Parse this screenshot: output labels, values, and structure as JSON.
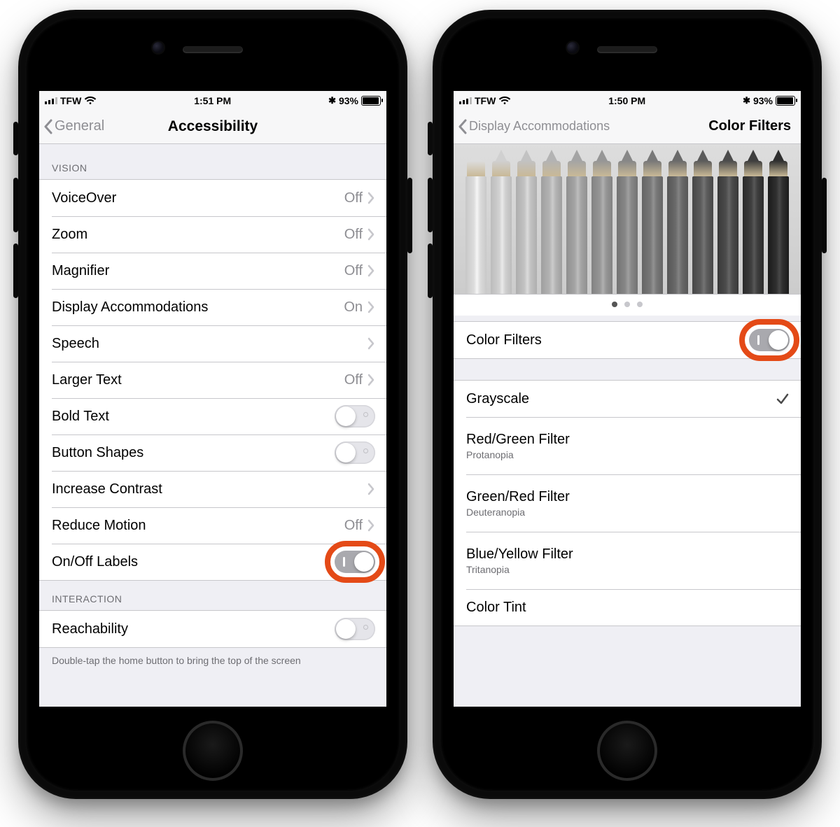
{
  "colors": {
    "highlight": "#e44a17"
  },
  "left": {
    "status": {
      "carrier": "TFW",
      "time": "1:51 PM",
      "battery_pct": "93%"
    },
    "nav": {
      "back": "General",
      "title": "Accessibility"
    },
    "sections": {
      "vision": {
        "header": "VISION",
        "rows": [
          {
            "label": "VoiceOver",
            "value": "Off",
            "chevron": true
          },
          {
            "label": "Zoom",
            "value": "Off",
            "chevron": true
          },
          {
            "label": "Magnifier",
            "value": "Off",
            "chevron": true
          },
          {
            "label": "Display Accommodations",
            "value": "On",
            "chevron": true
          },
          {
            "label": "Speech",
            "value": "",
            "chevron": true
          },
          {
            "label": "Larger Text",
            "value": "Off",
            "chevron": true
          },
          {
            "label": "Bold Text",
            "toggle": "off"
          },
          {
            "label": "Button Shapes",
            "toggle": "off"
          },
          {
            "label": "Increase Contrast",
            "value": "",
            "chevron": true
          },
          {
            "label": "Reduce Motion",
            "value": "Off",
            "chevron": true
          },
          {
            "label": "On/Off Labels",
            "toggle": "on",
            "highlight": true
          }
        ]
      },
      "interaction": {
        "header": "INTERACTION",
        "rows": [
          {
            "label": "Reachability",
            "toggle": "off"
          }
        ],
        "footer": "Double-tap the home button to bring the top of the screen"
      }
    }
  },
  "right": {
    "status": {
      "carrier": "TFW",
      "time": "1:50 PM",
      "battery_pct": "93%"
    },
    "nav": {
      "back": "Display Accommodations",
      "title": "Color Filters"
    },
    "page_dots": {
      "count": 3,
      "active": 0
    },
    "colorfilters": {
      "toggle_row": {
        "label": "Color Filters",
        "toggle": "on",
        "highlight": true
      },
      "options": [
        {
          "label": "Grayscale",
          "sub": "",
          "selected": true
        },
        {
          "label": "Red/Green Filter",
          "sub": "Protanopia"
        },
        {
          "label": "Green/Red Filter",
          "sub": "Deuteranopia"
        },
        {
          "label": "Blue/Yellow Filter",
          "sub": "Tritanopia"
        },
        {
          "label": "Color Tint",
          "sub": ""
        }
      ]
    },
    "pencil_shades": [
      "#dcdcdc",
      "#d0d0d0",
      "#c2c2c2",
      "#b3b3b3",
      "#a4a4a4",
      "#969696",
      "#878787",
      "#787878",
      "#6a6a6a",
      "#5b5b5b",
      "#4c4c4c",
      "#3e3e3e",
      "#2f2f2f"
    ]
  }
}
